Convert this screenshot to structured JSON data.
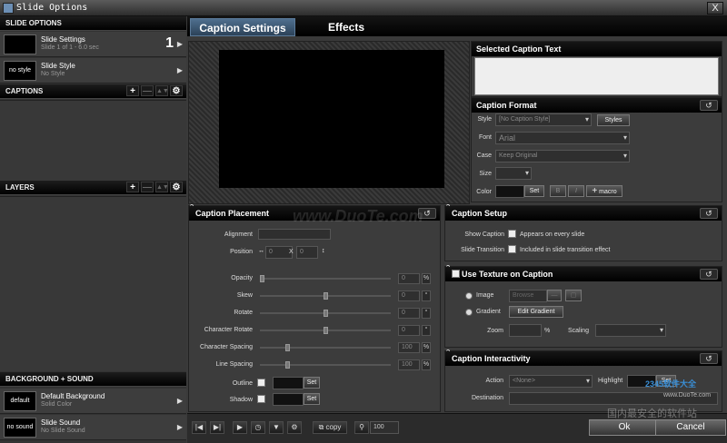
{
  "window": {
    "title": "Slide Options",
    "close": "X"
  },
  "tabs": [
    {
      "label": "Caption Settings"
    },
    {
      "label": "Effects"
    }
  ],
  "left": {
    "slide_options_header": "SLIDE OPTIONS",
    "slide_settings": {
      "title": "Slide Settings",
      "sub": "Slide 1 of 1 - 6.0 sec",
      "number": "1"
    },
    "slide_style": {
      "thumb": "no style",
      "title": "Slide Style",
      "sub": "No Style"
    },
    "captions_header": "CAPTIONS",
    "layers_header": "LAYERS",
    "bg_header": "BACKGROUND + SOUND",
    "background": {
      "thumb": "default",
      "title": "Default Background",
      "sub": "Solid Color"
    },
    "sound": {
      "thumb": "no sound",
      "title": "Slide Sound",
      "sub": "No Slide Sound"
    }
  },
  "selected_caption": {
    "header": "Selected Caption Text"
  },
  "caption_format": {
    "header": "Caption Format",
    "style_label": "Style",
    "style_value": "[No Caption Style]",
    "styles_btn": "Styles",
    "font_label": "Font",
    "font_value": "Arial",
    "case_label": "Case",
    "case_value": "Keep Original",
    "size_label": "Size",
    "color_label": "Color",
    "set_btn": "Set",
    "macro_btn": "macro"
  },
  "placement": {
    "header": "Caption Placement",
    "alignment_label": "Alignment",
    "position_label": "Position",
    "pos_x": "0",
    "x_label": "X",
    "pos_y": "0",
    "rows": [
      {
        "label": "Opacity",
        "value": "0",
        "unit": "%",
        "level": 0.0
      },
      {
        "label": "Skew",
        "value": "0",
        "unit": "°",
        "level": 0.5
      },
      {
        "label": "Rotate",
        "value": "0",
        "unit": "°",
        "level": 0.5
      },
      {
        "label": "Character Rotate",
        "value": "0",
        "unit": "°",
        "level": 0.5
      },
      {
        "label": "Character Spacing",
        "value": "100",
        "unit": "%",
        "level": 0.2
      },
      {
        "label": "Line Spacing",
        "value": "100",
        "unit": "%",
        "level": 0.2
      }
    ],
    "outline_label": "Outline",
    "shadow_label": "Shadow",
    "set_btn": "Set"
  },
  "setup": {
    "header": "Caption Setup",
    "show_label": "Show Caption",
    "show_text": "Appears on every slide",
    "transition_label": "Slide Transition",
    "transition_text": "Included in slide transition effect"
  },
  "texture": {
    "header": "Use Texture on Caption",
    "image_label": "Image",
    "image_value": "Browse",
    "gradient_label": "Gradient",
    "edit_gradient": "Edit Gradient",
    "zoom_label": "Zoom",
    "zoom_unit": "%",
    "scaling_label": "Scaling"
  },
  "interactivity": {
    "header": "Caption Interactivity",
    "action_label": "Action",
    "action_value": "<None>",
    "highlight_label": "Highlight",
    "set_btn": "Set",
    "destination_label": "Destination"
  },
  "bottom": {
    "copy": "copy",
    "zoom_value": "100",
    "ok": "Ok",
    "cancel": "Cancel"
  },
  "watermarks": {
    "center": "www.DuoTe.com",
    "corner": "国内最安全的软件站",
    "corner_url": "www.DuoTe.com",
    "corner_brand": "2345软件大全"
  }
}
